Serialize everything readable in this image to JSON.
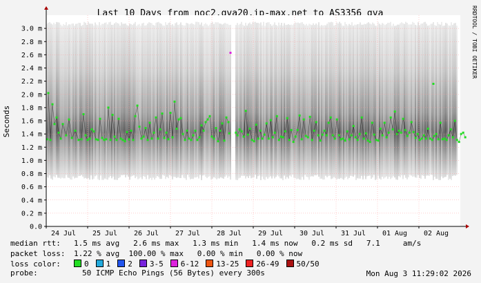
{
  "chart_data": {
    "type": "line",
    "title": "Last 10 Days from noc2.gva20.ip-max.net to AS3356_gva",
    "ylabel": "Seconds",
    "ylim": [
      0,
      0.0032
    ],
    "y_ticks": [
      {
        "value": 0,
        "label": "0.0"
      },
      {
        "value": 0.0002,
        "label": "0.2 m"
      },
      {
        "value": 0.0004,
        "label": "0.4 m"
      },
      {
        "value": 0.0006,
        "label": "0.6 m"
      },
      {
        "value": 0.0008,
        "label": "0.8 m"
      },
      {
        "value": 0.001,
        "label": "1.0 m"
      },
      {
        "value": 0.0012,
        "label": "1.2 m"
      },
      {
        "value": 0.0014,
        "label": "1.4 m"
      },
      {
        "value": 0.0016,
        "label": "1.6 m"
      },
      {
        "value": 0.0018,
        "label": "1.8 m"
      },
      {
        "value": 0.002,
        "label": "2.0 m"
      },
      {
        "value": 0.0022,
        "label": "2.2 m"
      },
      {
        "value": 0.0024,
        "label": "2.4 m"
      },
      {
        "value": 0.0026,
        "label": "2.6 m"
      },
      {
        "value": 0.0028,
        "label": "2.8 m"
      },
      {
        "value": 0.003,
        "label": "3.0 m"
      }
    ],
    "x_range_days": [
      0,
      10
    ],
    "x_ticks": [
      {
        "day": 0,
        "label": "24 Jul"
      },
      {
        "day": 1,
        "label": "25 Jul"
      },
      {
        "day": 2,
        "label": "26 Jul"
      },
      {
        "day": 3,
        "label": "27 Jul"
      },
      {
        "day": 4,
        "label": "28 Jul"
      },
      {
        "day": 5,
        "label": "29 Jul"
      },
      {
        "day": 6,
        "label": "30 Jul"
      },
      {
        "day": 7,
        "label": "31 Jul"
      },
      {
        "day": 8,
        "label": "01 Aug"
      },
      {
        "day": 9,
        "label": "02 Aug"
      }
    ],
    "gap_days": [
      4.45,
      4.55
    ],
    "smoke_min_s": 0.0007,
    "smoke_max_s": 0.0031,
    "median_series": {
      "name": "median rtt",
      "color": "#22dd22",
      "points": [
        [
          0.02,
          1.32
        ],
        [
          0.05,
          2.02
        ],
        [
          0.1,
          1.31
        ],
        [
          0.15,
          1.85
        ],
        [
          0.2,
          1.55
        ],
        [
          0.25,
          1.65
        ],
        [
          0.3,
          1.42
        ],
        [
          0.35,
          1.33
        ],
        [
          0.4,
          1.55
        ],
        [
          0.48,
          1.38
        ],
        [
          0.55,
          1.62
        ],
        [
          0.62,
          1.34
        ],
        [
          0.7,
          1.45
        ],
        [
          0.78,
          1.31
        ],
        [
          0.85,
          1.32
        ],
        [
          0.9,
          1.7
        ],
        [
          0.95,
          1.38
        ],
        [
          1.0,
          1.31
        ],
        [
          1.05,
          1.33
        ],
        [
          1.1,
          1.47
        ],
        [
          1.15,
          1.44
        ],
        [
          1.2,
          1.32
        ],
        [
          1.25,
          1.31
        ],
        [
          1.3,
          1.63
        ],
        [
          1.35,
          1.34
        ],
        [
          1.4,
          1.31
        ],
        [
          1.45,
          1.32
        ],
        [
          1.5,
          1.8
        ],
        [
          1.55,
          1.31
        ],
        [
          1.6,
          1.69
        ],
        [
          1.65,
          1.36
        ],
        [
          1.7,
          1.31
        ],
        [
          1.75,
          1.63
        ],
        [
          1.8,
          1.33
        ],
        [
          1.85,
          1.31
        ],
        [
          1.9,
          1.29
        ],
        [
          1.95,
          1.43
        ],
        [
          2.0,
          1.32
        ],
        [
          2.05,
          1.45
        ],
        [
          2.1,
          1.31
        ],
        [
          2.15,
          1.67
        ],
        [
          2.2,
          1.83
        ],
        [
          2.25,
          1.51
        ],
        [
          2.3,
          1.33
        ],
        [
          2.35,
          1.36
        ],
        [
          2.4,
          1.49
        ],
        [
          2.45,
          1.31
        ],
        [
          2.5,
          1.57
        ],
        [
          2.55,
          1.33
        ],
        [
          2.6,
          1.42
        ],
        [
          2.65,
          1.65
        ],
        [
          2.7,
          1.33
        ],
        [
          2.75,
          1.47
        ],
        [
          2.8,
          1.71
        ],
        [
          2.85,
          1.34
        ],
        [
          2.9,
          1.42
        ],
        [
          2.95,
          1.32
        ],
        [
          3.0,
          1.72
        ],
        [
          3.05,
          1.35
        ],
        [
          3.1,
          1.89
        ],
        [
          3.15,
          1.48
        ],
        [
          3.2,
          1.62
        ],
        [
          3.25,
          1.64
        ],
        [
          3.3,
          1.4
        ],
        [
          3.35,
          1.31
        ],
        [
          3.4,
          1.45
        ],
        [
          3.45,
          1.33
        ],
        [
          3.5,
          1.31
        ],
        [
          3.55,
          1.38
        ],
        [
          3.6,
          1.45
        ],
        [
          3.65,
          1.31
        ],
        [
          3.7,
          1.35
        ],
        [
          3.75,
          1.53
        ],
        [
          3.8,
          1.45
        ],
        [
          3.85,
          1.58
        ],
        [
          3.9,
          1.62
        ],
        [
          3.95,
          1.67
        ],
        [
          4.0,
          1.36
        ],
        [
          4.05,
          1.33
        ],
        [
          4.1,
          1.49
        ],
        [
          4.15,
          1.29
        ],
        [
          4.2,
          1.45
        ],
        [
          4.25,
          1.56
        ],
        [
          4.3,
          1.3
        ],
        [
          4.35,
          1.65
        ],
        [
          4.4,
          1.58
        ],
        [
          4.42,
          1.41
        ],
        [
          4.58,
          1.42
        ],
        [
          4.62,
          1.38
        ],
        [
          4.67,
          1.47
        ],
        [
          4.72,
          1.44
        ],
        [
          4.77,
          1.36
        ],
        [
          4.82,
          1.75
        ],
        [
          4.87,
          1.39
        ],
        [
          4.92,
          1.48
        ],
        [
          4.97,
          1.31
        ],
        [
          5.02,
          1.29
        ],
        [
          5.07,
          1.54
        ],
        [
          5.12,
          1.33
        ],
        [
          5.17,
          1.45
        ],
        [
          5.22,
          1.33
        ],
        [
          5.27,
          1.39
        ],
        [
          5.32,
          1.56
        ],
        [
          5.37,
          1.33
        ],
        [
          5.42,
          1.61
        ],
        [
          5.47,
          1.35
        ],
        [
          5.52,
          1.42
        ],
        [
          5.57,
          1.67
        ],
        [
          5.62,
          1.31
        ],
        [
          5.67,
          1.36
        ],
        [
          5.72,
          1.35
        ],
        [
          5.77,
          1.44
        ],
        [
          5.82,
          1.64
        ],
        [
          5.87,
          1.31
        ],
        [
          5.92,
          1.46
        ],
        [
          5.97,
          1.28
        ],
        [
          6.02,
          1.36
        ],
        [
          6.07,
          1.46
        ],
        [
          6.12,
          1.68
        ],
        [
          6.17,
          1.32
        ],
        [
          6.22,
          1.62
        ],
        [
          6.27,
          1.37
        ],
        [
          6.32,
          1.35
        ],
        [
          6.37,
          1.66
        ],
        [
          6.42,
          1.31
        ],
        [
          6.47,
          1.45
        ],
        [
          6.52,
          1.58
        ],
        [
          6.57,
          1.38
        ],
        [
          6.62,
          1.3
        ],
        [
          6.67,
          1.39
        ],
        [
          6.72,
          1.45
        ],
        [
          6.77,
          1.38
        ],
        [
          6.82,
          1.57
        ],
        [
          6.87,
          1.65
        ],
        [
          6.92,
          1.38
        ],
        [
          6.97,
          1.33
        ],
        [
          7.02,
          1.62
        ],
        [
          7.07,
          1.38
        ],
        [
          7.12,
          1.32
        ],
        [
          7.17,
          1.33
        ],
        [
          7.22,
          1.3
        ],
        [
          7.27,
          1.44
        ],
        [
          7.32,
          1.32
        ],
        [
          7.37,
          1.38
        ],
        [
          7.42,
          1.52
        ],
        [
          7.47,
          1.35
        ],
        [
          7.52,
          1.31
        ],
        [
          7.57,
          1.4
        ],
        [
          7.62,
          1.65
        ],
        [
          7.67,
          1.33
        ],
        [
          7.72,
          1.41
        ],
        [
          7.77,
          1.3
        ],
        [
          7.82,
          1.28
        ],
        [
          7.87,
          1.57
        ],
        [
          7.92,
          1.39
        ],
        [
          7.97,
          1.31
        ],
        [
          8.02,
          1.3
        ],
        [
          8.07,
          1.48
        ],
        [
          8.12,
          1.38
        ],
        [
          8.17,
          1.57
        ],
        [
          8.22,
          1.35
        ],
        [
          8.27,
          1.42
        ],
        [
          8.32,
          1.65
        ],
        [
          8.37,
          1.47
        ],
        [
          8.42,
          1.74
        ],
        [
          8.47,
          1.4
        ],
        [
          8.52,
          1.45
        ],
        [
          8.57,
          1.42
        ],
        [
          8.62,
          1.63
        ],
        [
          8.67,
          1.46
        ],
        [
          8.72,
          1.37
        ],
        [
          8.77,
          1.42
        ],
        [
          8.82,
          1.58
        ],
        [
          8.87,
          1.43
        ],
        [
          8.92,
          1.34
        ],
        [
          8.97,
          1.4
        ],
        [
          9.02,
          1.31
        ],
        [
          9.07,
          1.33
        ],
        [
          9.12,
          1.38
        ],
        [
          9.17,
          1.33
        ],
        [
          9.22,
          1.48
        ],
        [
          9.27,
          1.33
        ],
        [
          9.32,
          1.31
        ],
        [
          9.37,
          1.37
        ],
        [
          9.42,
          1.4
        ],
        [
          9.47,
          1.32
        ],
        [
          9.52,
          1.57
        ],
        [
          9.57,
          1.32
        ],
        [
          9.62,
          1.33
        ],
        [
          9.67,
          1.31
        ],
        [
          9.72,
          1.38
        ],
        [
          9.77,
          1.47
        ],
        [
          9.82,
          1.35
        ],
        [
          9.87,
          1.6
        ],
        [
          9.92,
          1.31
        ],
        [
          9.97,
          1.28
        ],
        [
          10.02,
          1.4
        ],
        [
          10.07,
          1.42
        ],
        [
          10.12,
          1.35
        ]
      ],
      "extra": [
        [
          9.35,
          2.16
        ]
      ]
    },
    "outlier_markers": [
      [
        4.45,
        2.63
      ]
    ]
  },
  "side_label": "RRDTOOL / TOBI OETIKER",
  "stats": {
    "median_label": "median rtt:",
    "median_values": "1.5 ms avg   2.6 ms max   1.3 ms min   1.4 ms now   0.2 ms sd   7.1     am/s",
    "loss_label": "packet loss:",
    "loss_values": "1.22 % avg  100.00 % max   0.00 % min   0.00 % now",
    "color_label": "loss color:",
    "probe_label": "probe:",
    "probe_values": "50 ICMP Echo Pings (56 Bytes) every 300s"
  },
  "loss_legend": [
    {
      "label": "0",
      "color": "#22dd22"
    },
    {
      "label": "1",
      "color": "#22aadd"
    },
    {
      "label": "2",
      "color": "#2255ee"
    },
    {
      "label": "3-5",
      "color": "#7722dd"
    },
    {
      "label": "6-12",
      "color": "#dd22dd"
    },
    {
      "label": "13-25",
      "color": "#ee5511"
    },
    {
      "label": "26-49",
      "color": "#ee2222"
    },
    {
      "label": "50/50",
      "color": "#aa1111"
    }
  ],
  "timestamp": "Mon Aug  3 11:29:02 2026"
}
